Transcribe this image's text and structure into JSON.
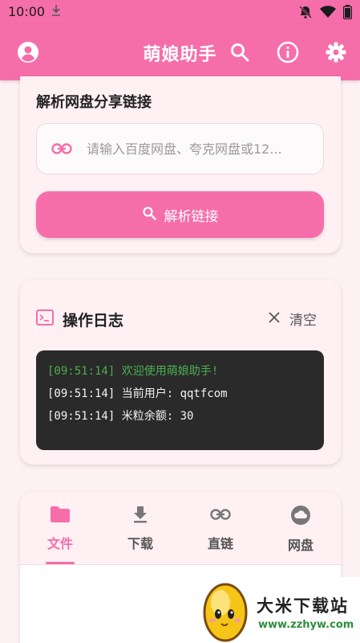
{
  "status_bar": {
    "time": "10:00"
  },
  "app_bar": {
    "title": "萌娘助手",
    "icons": [
      "account-icon",
      "search-icon",
      "info-icon",
      "settings-icon"
    ]
  },
  "parse_card": {
    "heading": "解析网盘分享链接",
    "input_placeholder": "请输入百度网盘、夸克网盘或12...",
    "input_value": "",
    "parse_button_label": "解析链接"
  },
  "log_card": {
    "heading": "操作日志",
    "clear_label": "清空",
    "lines": [
      {
        "text": "[09:51:14] 欢迎使用萌娘助手!",
        "color": "#4caf50"
      },
      {
        "text": "[09:51:14] 当前用户: qqtfcom",
        "color": "#f2f2f2"
      },
      {
        "text": "[09:51:14] 米粒余额: 30",
        "color": "#f2f2f2"
      }
    ]
  },
  "tabs": [
    {
      "label": "文件",
      "icon": "folder-icon",
      "active": true
    },
    {
      "label": "下载",
      "icon": "download-icon",
      "active": false
    },
    {
      "label": "直链",
      "icon": "link-icon",
      "active": false
    },
    {
      "label": "网盘",
      "icon": "cloud-icon",
      "active": false
    }
  ],
  "watermark": {
    "title": "大米下载站",
    "url": "www.zzhyw.com"
  },
  "colors": {
    "accent": "#f56eaa",
    "background": "#fdf1f4",
    "card": "#fff0f4",
    "terminal": "#2a2a2a",
    "log_success": "#4caf50"
  }
}
